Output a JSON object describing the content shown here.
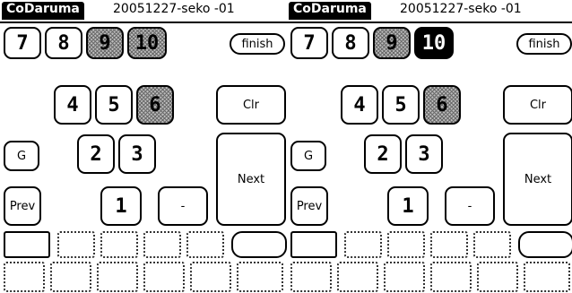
{
  "panels": [
    {
      "app_name": "CoDaruma",
      "doc_title": "20051227-seko -01",
      "buttons": {
        "b7": "7",
        "b8": "8",
        "b9": "9",
        "b10": "10",
        "finish": "finish",
        "b4": "4",
        "b5": "5",
        "b6": "6",
        "clr": "Clr",
        "g": "G",
        "b2": "2",
        "b3": "3",
        "next": "Next",
        "prev": "Prev",
        "b1": "1",
        "minus": "-"
      }
    },
    {
      "app_name": "CoDaruma",
      "doc_title": "20051227-seko -01",
      "buttons": {
        "b7": "7",
        "b8": "8",
        "b9": "9",
        "b10": "10",
        "finish": "finish",
        "b4": "4",
        "b5": "5",
        "b6": "6",
        "clr": "Clr",
        "g": "G",
        "b2": "2",
        "b3": "3",
        "next": "Next",
        "prev": "Prev",
        "b1": "1",
        "minus": "-"
      }
    }
  ],
  "icons": {
    "hatched_state": "struck-pin-pattern",
    "selected_state": "inverted-black"
  },
  "colors": {
    "background": "#ffffff",
    "foreground": "#000000",
    "hatch": "#8c8c8c"
  }
}
